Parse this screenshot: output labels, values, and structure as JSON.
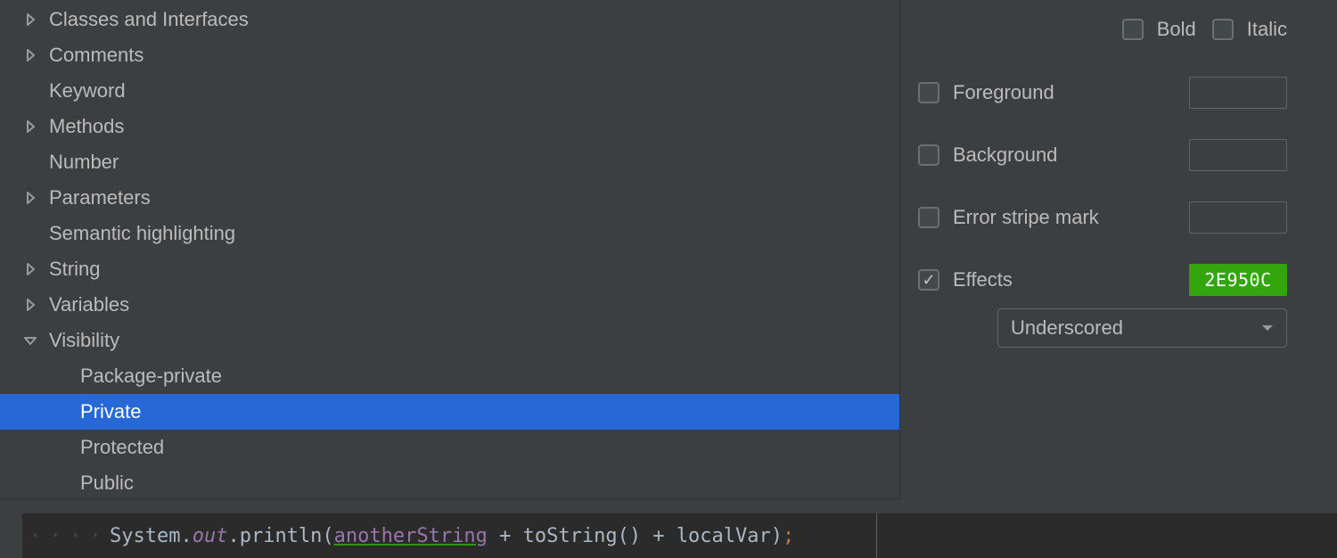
{
  "tree": {
    "items": [
      {
        "label": "Classes and Interfaces",
        "arrow": "right",
        "indent": 0,
        "selected": false
      },
      {
        "label": "Comments",
        "arrow": "right",
        "indent": 0,
        "selected": false
      },
      {
        "label": "Keyword",
        "arrow": "none",
        "indent": 0,
        "selected": false
      },
      {
        "label": "Methods",
        "arrow": "right",
        "indent": 0,
        "selected": false
      },
      {
        "label": "Number",
        "arrow": "none",
        "indent": 0,
        "selected": false
      },
      {
        "label": "Parameters",
        "arrow": "right",
        "indent": 0,
        "selected": false
      },
      {
        "label": "Semantic highlighting",
        "arrow": "none",
        "indent": 0,
        "selected": false
      },
      {
        "label": "String",
        "arrow": "right",
        "indent": 0,
        "selected": false
      },
      {
        "label": "Variables",
        "arrow": "right",
        "indent": 0,
        "selected": false
      },
      {
        "label": "Visibility",
        "arrow": "down",
        "indent": 0,
        "selected": false
      },
      {
        "label": "Package-private",
        "arrow": "none",
        "indent": 1,
        "selected": false
      },
      {
        "label": "Private",
        "arrow": "none",
        "indent": 1,
        "selected": true
      },
      {
        "label": "Protected",
        "arrow": "none",
        "indent": 1,
        "selected": false
      },
      {
        "label": "Public",
        "arrow": "none",
        "indent": 1,
        "selected": false
      }
    ]
  },
  "props": {
    "bold_label": "Bold",
    "bold_checked": false,
    "italic_label": "Italic",
    "italic_checked": false,
    "foreground_label": "Foreground",
    "foreground_checked": false,
    "background_label": "Background",
    "background_checked": false,
    "error_stripe_label": "Error stripe mark",
    "error_stripe_checked": false,
    "effects_label": "Effects",
    "effects_checked": true,
    "effects_color_hex": "2E950C",
    "effects_type": "Underscored"
  },
  "preview": {
    "class": "System",
    "field": "out",
    "method": "println",
    "arg": "anotherString",
    "op1": " + ",
    "call": "toString()",
    "op2": " + ",
    "local": "localVar",
    "terminator": ";"
  }
}
